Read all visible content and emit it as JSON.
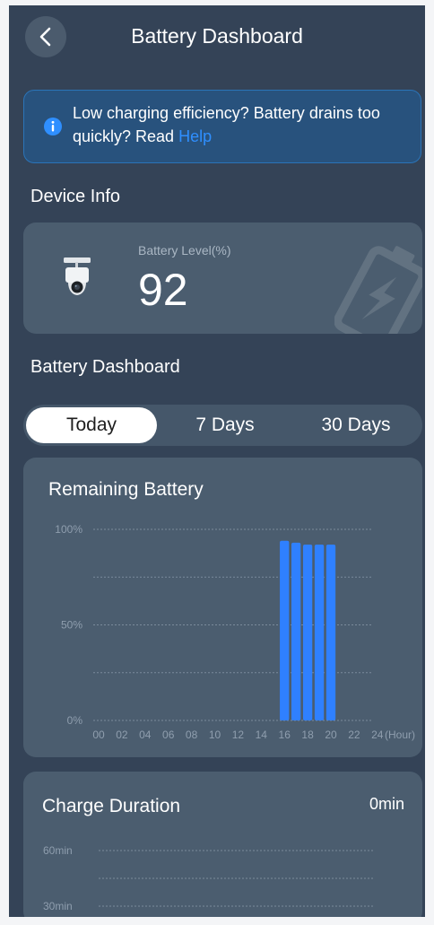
{
  "header": {
    "title": "Battery Dashboard"
  },
  "notice": {
    "text": "Low charging efficiency? Battery drains too quickly? Read ",
    "link": "Help"
  },
  "device_info": {
    "section_title": "Device Info",
    "battery_label": "Battery Level(%)",
    "battery_value": "92"
  },
  "dashboard": {
    "section_title": "Battery Dashboard",
    "tabs": [
      {
        "label": "Today",
        "active": true
      },
      {
        "label": "7 Days",
        "active": false
      },
      {
        "label": "30 Days",
        "active": false
      }
    ]
  },
  "remaining_chart": {
    "title": "Remaining Battery"
  },
  "charge_duration": {
    "title": "Charge Duration",
    "value": "0min",
    "y_ticks": [
      "60min",
      "30min"
    ]
  },
  "colors": {
    "accent": "#2f80ff",
    "background": "#344357",
    "card": "#4b5d6f",
    "link": "#2f8fff"
  },
  "chart_data": {
    "type": "bar",
    "title": "Remaining Battery",
    "x_unit": "(Hour)",
    "x_tick_labels": [
      "00",
      "02",
      "04",
      "06",
      "08",
      "10",
      "12",
      "14",
      "16",
      "18",
      "20",
      "22",
      "24"
    ],
    "y_tick_labels": [
      "100%",
      "50%",
      "0%"
    ],
    "ylim": [
      0,
      100
    ],
    "grid": true,
    "categories": [
      "16",
      "17",
      "18",
      "19",
      "20"
    ],
    "values": [
      94,
      93,
      92,
      92,
      92
    ]
  }
}
